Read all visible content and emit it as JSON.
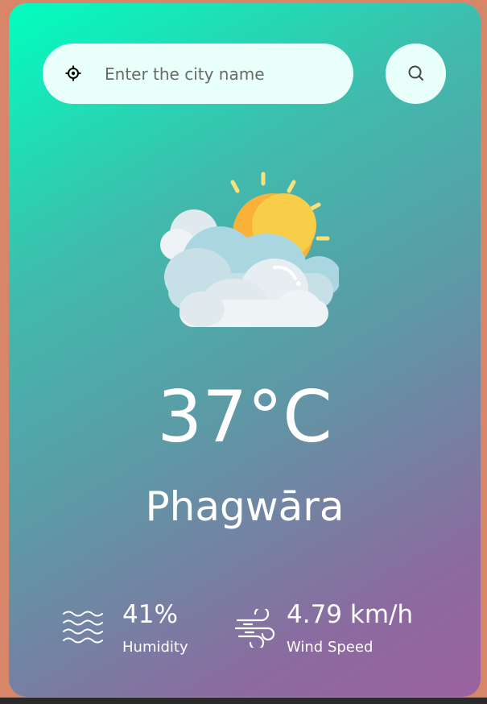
{
  "search": {
    "placeholder": "Enter the city name",
    "location_icon": "crosshair-icon",
    "search_icon": "magnifier-icon"
  },
  "weather": {
    "condition_icon": "sun-behind-clouds-icon",
    "temperature": "37°C",
    "city": "Phagwāra"
  },
  "details": {
    "humidity": {
      "value": "41%",
      "label": "Humidity",
      "icon": "water-waves-icon"
    },
    "wind": {
      "value": "4.79 km/h",
      "label": "Wind Speed",
      "icon": "wind-icon"
    }
  },
  "colors": {
    "page_background": "#d8866a",
    "gradient_start": "#00ffbf",
    "gradient_mid": "#5c9aa6",
    "gradient_end": "#9b62a0",
    "search_background": "#e9fff9",
    "text": "#ffffff"
  }
}
